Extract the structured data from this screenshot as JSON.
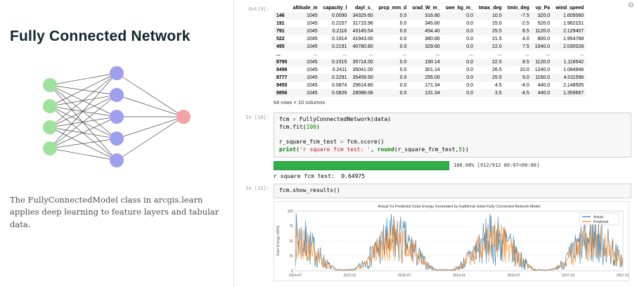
{
  "left_panel": {
    "title": "Fully Connected Network",
    "description": "The FullyConnectedModel class in arcgis.learn applies deep learning to feature layers and tabular data.",
    "network": {
      "layers": [
        4,
        5,
        1
      ],
      "spacing": [
        30,
        31,
        0
      ],
      "colors": [
        "#9FE29B",
        "#9F9FEF",
        "#F2A3A3"
      ],
      "edge_color": "#4a4a4a"
    }
  },
  "notebook": {
    "out_prompt": "Out[9]:",
    "popout_icon": "⧉",
    "table": {
      "columns": [
        "",
        "altitude_m",
        "capacity_l",
        "dayl_s_",
        "prcp_mm_d",
        "srad_W_m_",
        "swe_kg_m_",
        "tmax_deg",
        "tmin_deg",
        "vp_Pa",
        "wind_speed"
      ],
      "rows": [
        [
          "146",
          "1045",
          "0.0090",
          "34329.60",
          "0.0",
          "316.80",
          "0.0",
          "10.0",
          "-7.5",
          "320.0",
          "1.609560"
        ],
        [
          "191",
          "1045",
          "0.2157",
          "31715.96",
          "0.0",
          "345.60",
          "0.0",
          "15.0",
          "-2.5",
          "520.0",
          "1.962151"
        ],
        [
          "791",
          "1045",
          "0.2116",
          "43145.54",
          "0.0",
          "454.40",
          "0.0",
          "25.5",
          "8.5",
          "1120.0",
          "2.129407"
        ],
        [
          "522",
          "1045",
          "0.1914",
          "41943.00",
          "0.0",
          "380.80",
          "0.0",
          "21.5",
          "4.0",
          "800.0",
          "1.954768"
        ],
        [
          "495",
          "1045",
          "0.2191",
          "40780.80",
          "0.0",
          "329.60",
          "0.0",
          "22.0",
          "7.5",
          "1040.0",
          "2.030028"
        ],
        [
          "...",
          "...",
          "...",
          "...",
          "...",
          "...",
          "...",
          "...",
          "...",
          "...",
          "..."
        ],
        [
          "8790",
          "1045",
          "0.2315",
          "35714.00",
          "0.0",
          "190.14",
          "0.0",
          "22.5",
          "8.5",
          "1120.0",
          "1.118542"
        ],
        [
          "8498",
          "1045",
          "0.2411",
          "35041.00",
          "0.0",
          "301.14",
          "0.0",
          "26.5",
          "10.0",
          "1240.0",
          "1.084946"
        ],
        [
          "8777",
          "1045",
          "0.2291",
          "35459.50",
          "0.0",
          "255.00",
          "0.0",
          "25.5",
          "9.0",
          "1160.0",
          "4.011596"
        ],
        [
          "9455",
          "1045",
          "0.0874",
          "29614.80",
          "0.0",
          "171.34",
          "0.0",
          "4.5",
          "-4.0",
          "440.0",
          "2.148505"
        ],
        [
          "9856",
          "1045",
          "0.0829",
          "28088.06",
          "0.0",
          "131.34",
          "0.0",
          "3.5",
          "-4.5",
          "440.0",
          "1.359667"
        ]
      ],
      "shape_caption": "64 rows × 10 columns"
    },
    "fit_cell": {
      "prompt": "In [10]:",
      "lines": [
        [
          {
            "t": "fcm ",
            "c": "p"
          },
          {
            "t": "=",
            "c": "o"
          },
          {
            "t": " FullyConnectedNetwork(data)",
            "c": "p"
          }
        ],
        [
          {
            "t": "fcm.fit(",
            "c": "p"
          },
          {
            "t": "100",
            "c": "num"
          },
          {
            "t": ")",
            "c": "p"
          }
        ],
        [
          {
            "t": "",
            "c": "p"
          }
        ],
        [
          {
            "t": "r_square_fcm_test ",
            "c": "p"
          },
          {
            "t": "=",
            "c": "o"
          },
          {
            "t": " fcm.score()",
            "c": "p"
          }
        ],
        [
          {
            "t": "print",
            "c": "k"
          },
          {
            "t": "(",
            "c": "p"
          },
          {
            "t": "'r square fcm test: '",
            "c": "s"
          },
          {
            "t": ", ",
            "c": "p"
          },
          {
            "t": "round",
            "c": "k"
          },
          {
            "t": "(r_square_fcm_test,",
            "c": "p"
          },
          {
            "t": "5",
            "c": "num"
          },
          {
            "t": "))",
            "c": "p"
          }
        ]
      ]
    },
    "progress": {
      "percent": "100.00%",
      "text": "100.00% [912/912 00:07<00:00]"
    },
    "score_output": "r square fcm test:  0.64975",
    "results_cell": {
      "prompt": "In [11]:",
      "lines": [
        [
          {
            "t": "fcm.show_results()",
            "c": "p"
          }
        ]
      ]
    }
  },
  "chart_data": {
    "type": "line",
    "title": "Actual Vs Predicted Solar Energy Generated by traditional Solar-Fully Connected Network Model",
    "ylabel": "Solar Energy (kWh)",
    "x_ticks": [
      "2014-07",
      "2015-01",
      "2015-07",
      "2016-01",
      "2016-07",
      "2017-01",
      "2017-07"
    ],
    "y_ticks": [
      0,
      25,
      50,
      75,
      100
    ],
    "ylim": [
      0,
      100
    ],
    "legend": [
      {
        "name": "Actual",
        "color": "#1f77b4"
      },
      {
        "name": "Predicted",
        "color": "#ff7f0e"
      }
    ],
    "n_points": 620,
    "seasons": 3.3,
    "seed": 7,
    "grid": true,
    "legend_position": "upper right"
  }
}
